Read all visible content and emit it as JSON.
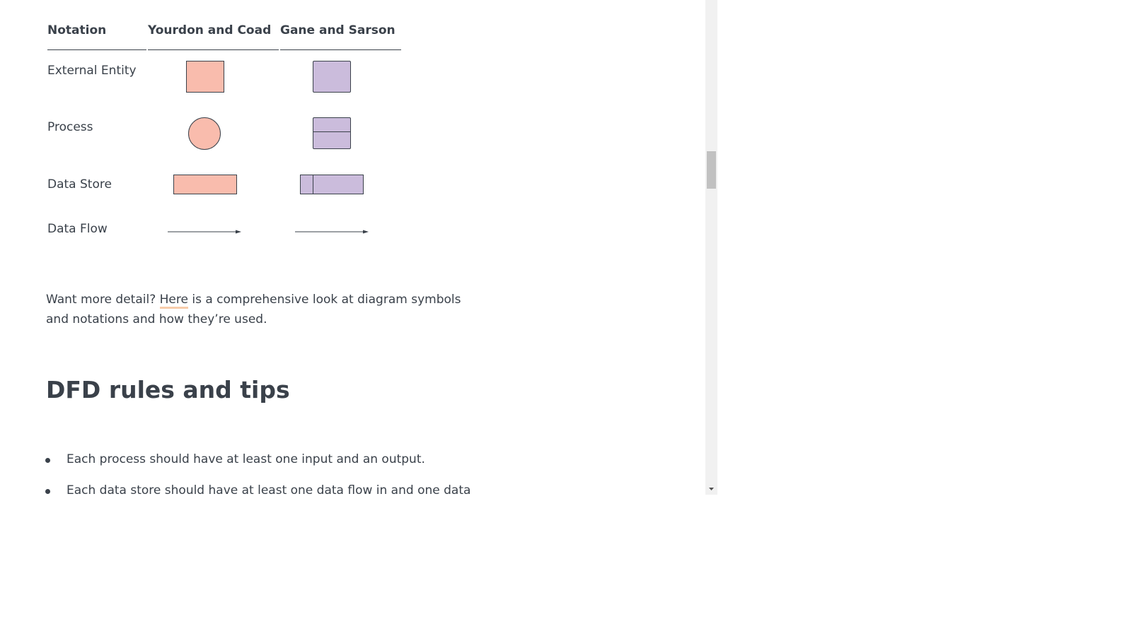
{
  "table": {
    "headers": [
      "Notation",
      "Yourdon and Coad",
      "Gane and Sarson"
    ],
    "rows": [
      "External Entity",
      "Process",
      "Data Store",
      "Data Flow"
    ]
  },
  "paragraph": {
    "before": "Want more detail? ",
    "link": "Here",
    "after": " is a comprehensive look at diagram symbols and notations and how they’re used."
  },
  "section_heading": "DFD rules and tips",
  "bullets": [
    "Each process should have at least one input and an output.",
    "Each data store should have at least one data flow in and one data"
  ],
  "colors": {
    "yourdon_fill": "#f9bcad",
    "gane_fill": "#cbbcdc",
    "text": "#3a414a",
    "link_underline": "#f8ccaa"
  }
}
